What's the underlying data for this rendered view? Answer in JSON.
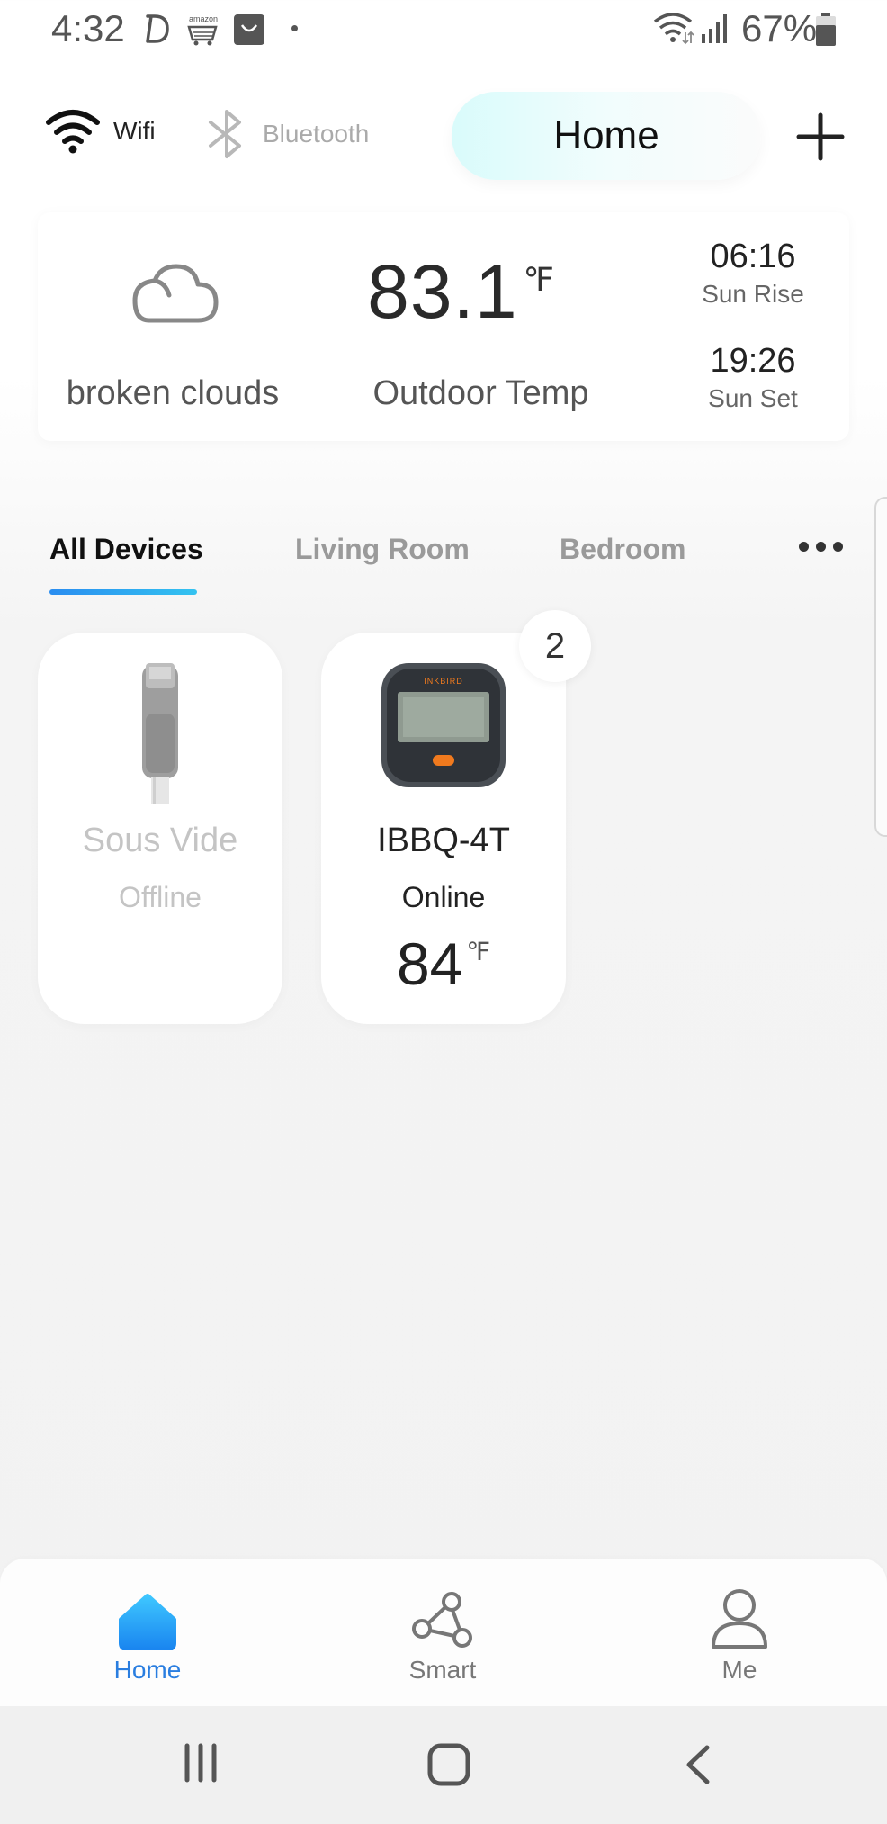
{
  "status_bar": {
    "time": "4:32",
    "battery": "67%",
    "icons": [
      "d-app-icon",
      "amazon-shopping-icon",
      "shopping-bag-icon",
      "dot-icon",
      "wifi-signal-icon",
      "cell-signal-icon",
      "battery-icon"
    ]
  },
  "top_bar": {
    "wifi_label": "Wifi",
    "bluetooth_label": "Bluetooth",
    "home_title": "Home",
    "add_icon": "plus-icon"
  },
  "weather": {
    "icon": "cloud-icon",
    "description": "broken clouds",
    "temperature": "83.1",
    "temperature_unit": "℉",
    "temperature_label": "Outdoor Temp",
    "sunrise_time": "06:16",
    "sunrise_label": "Sun Rise",
    "sunset_time": "19:26",
    "sunset_label": "Sun Set"
  },
  "tabs": {
    "items": [
      "All Devices",
      "Living Room",
      "Bedroom"
    ],
    "active": "All Devices"
  },
  "devices": [
    {
      "name": "Sous Vide",
      "status": "Offline"
    },
    {
      "name": "IBBQ-4T",
      "status": "Online",
      "temperature": "84",
      "unit": "℉",
      "badge": "2"
    }
  ],
  "bottom_nav": {
    "home": "Home",
    "smart": "Smart",
    "me": "Me"
  },
  "colors": {
    "accent_blue": "#2a7ee0",
    "home_pill": "#d9fbfb",
    "device_orange": "#f07a1e"
  }
}
